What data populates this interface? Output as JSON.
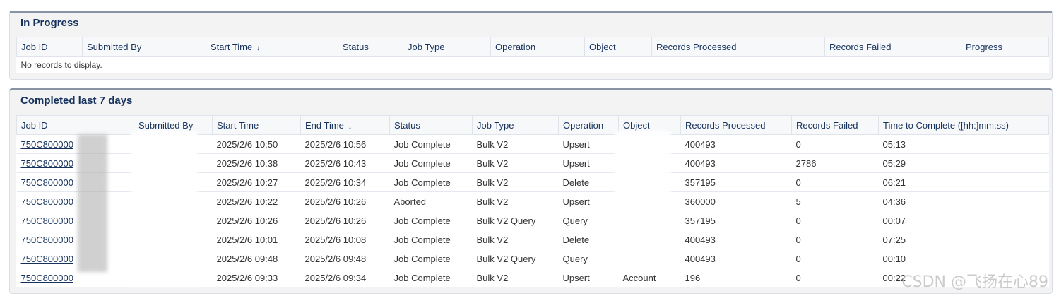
{
  "in_progress": {
    "title": "In Progress",
    "columns": [
      "Job ID",
      "Submitted By",
      "Start Time",
      "Status",
      "Job Type",
      "Operation",
      "Object",
      "Records Processed",
      "Records Failed",
      "Progress"
    ],
    "sort_arrow": "↓",
    "empty_message": "No records to display."
  },
  "completed": {
    "title": "Completed last 7 days",
    "columns": [
      "Job ID",
      "Submitted By",
      "Start Time",
      "End Time",
      "Status",
      "Job Type",
      "Operation",
      "Object",
      "Records Processed",
      "Records Failed",
      "Time to Complete ([hh:]mm:ss)"
    ],
    "sort_arrow": "↓",
    "rows": [
      {
        "job_id": "750C800000",
        "submitted_by": "",
        "start": "2025/2/6 10:50",
        "end": "2025/2/6 10:56",
        "status": "Job Complete",
        "job_type": "Bulk V2",
        "operation": "Upsert",
        "object": "",
        "processed": "400493",
        "failed": "0",
        "time": "05:13"
      },
      {
        "job_id": "750C800000",
        "submitted_by": "",
        "start": "2025/2/6 10:38",
        "end": "2025/2/6 10:43",
        "status": "Job Complete",
        "job_type": "Bulk V2",
        "operation": "Upsert",
        "object": "",
        "processed": "400493",
        "failed": "2786",
        "time": "05:29"
      },
      {
        "job_id": "750C800000",
        "submitted_by": "",
        "start": "2025/2/6 10:27",
        "end": "2025/2/6 10:34",
        "status": "Job Complete",
        "job_type": "Bulk V2",
        "operation": "Delete",
        "object": "",
        "processed": "357195",
        "failed": "0",
        "time": "06:21"
      },
      {
        "job_id": "750C800000",
        "submitted_by": "",
        "start": "2025/2/6 10:22",
        "end": "2025/2/6 10:26",
        "status": "Aborted",
        "job_type": "Bulk V2",
        "operation": "Upsert",
        "object": "",
        "processed": "360000",
        "failed": "5",
        "time": "04:36"
      },
      {
        "job_id": "750C800000",
        "submitted_by": "",
        "start": "2025/2/6 10:26",
        "end": "2025/2/6 10:26",
        "status": "Job Complete",
        "job_type": "Bulk V2 Query",
        "operation": "Query",
        "object": "",
        "processed": "357195",
        "failed": "0",
        "time": "00:07"
      },
      {
        "job_id": "750C800000",
        "submitted_by": "",
        "start": "2025/2/6 10:01",
        "end": "2025/2/6 10:08",
        "status": "Job Complete",
        "job_type": "Bulk V2",
        "operation": "Delete",
        "object": "",
        "processed": "400493",
        "failed": "0",
        "time": "07:25"
      },
      {
        "job_id": "750C800000",
        "submitted_by": "",
        "start": "2025/2/6 09:48",
        "end": "2025/2/6 09:48",
        "status": "Job Complete",
        "job_type": "Bulk V2 Query",
        "operation": "Query",
        "object": "",
        "processed": "400493",
        "failed": "0",
        "time": "00:10"
      },
      {
        "job_id": "750C800000",
        "submitted_by": "",
        "start": "2025/2/6 09:33",
        "end": "2025/2/6 09:34",
        "status": "Job Complete",
        "job_type": "Bulk V2",
        "operation": "Upsert",
        "object": "Account",
        "processed": "196",
        "failed": "0",
        "time": "00:22"
      }
    ]
  },
  "watermark": "CSDN @飞扬在心89",
  "colors": {
    "card_border": "#8a93a4",
    "text": "#16325c",
    "header_bg": "#f7f8fa"
  }
}
